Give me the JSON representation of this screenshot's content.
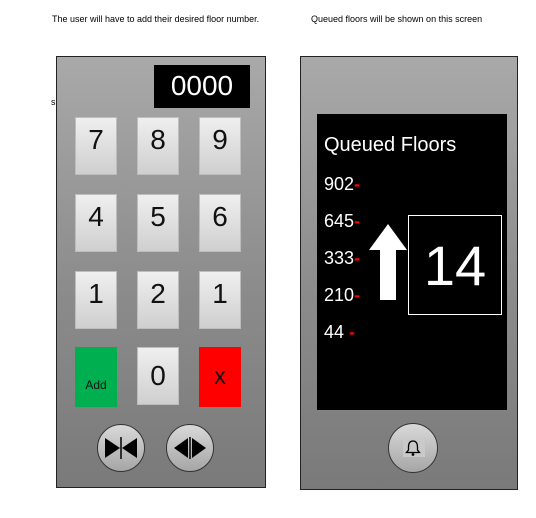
{
  "captions": {
    "left": "The user will have to add their desired floor number.",
    "right": "Queued floors will be shown on this screen",
    "stray": "s"
  },
  "keypad": {
    "display": "0000",
    "keys": [
      "7",
      "8",
      "9",
      "4",
      "5",
      "6",
      "1",
      "2",
      "1"
    ],
    "add_label": "Add",
    "zero_label": "0",
    "cancel_label": "x",
    "door_open_icon": "door-open-icon",
    "door_close_icon": "door-close-icon"
  },
  "queue": {
    "title": "Queued Floors",
    "floors": [
      "902",
      "645",
      "333",
      "210",
      "44"
    ],
    "current_floor": "14",
    "direction": "up",
    "alarm_icon": "bell-icon"
  },
  "colors": {
    "add": "#00b050",
    "cancel": "#ff0000",
    "dash": "#ff0000",
    "screen": "#000000"
  }
}
